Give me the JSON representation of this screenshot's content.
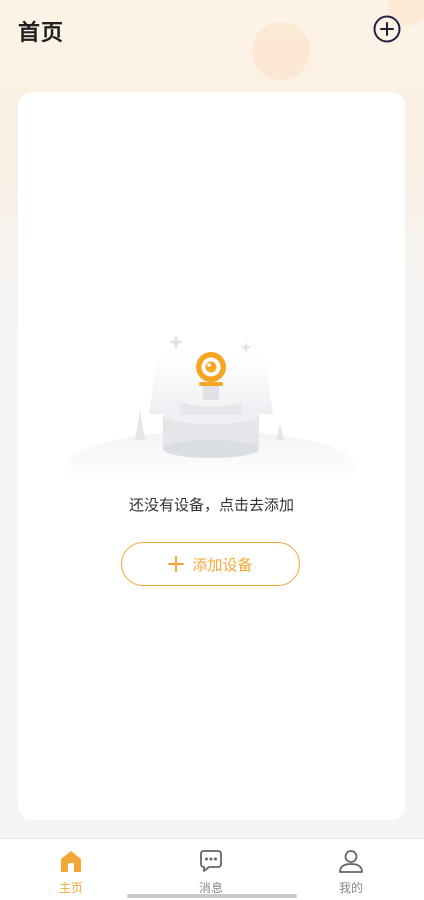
{
  "header": {
    "title": "首页",
    "add_icon": "plus-circle-icon"
  },
  "empty_state": {
    "illustration": "camera-on-pedestal-illustration",
    "message": "还没有设备，点击去添加",
    "add_button_label": "添加设备",
    "add_button_icon": "plus-icon"
  },
  "tabbar": {
    "items": [
      {
        "label": "主页",
        "icon": "home-icon",
        "active": true
      },
      {
        "label": "消息",
        "icon": "chat-bubble-icon",
        "active": false
      },
      {
        "label": "我的",
        "icon": "user-icon",
        "active": false
      }
    ]
  },
  "colors": {
    "accent": "#f3a737",
    "background": "#f4f5f7",
    "card": "#ffffff",
    "text_primary": "#1f1f1f",
    "tab_inactive": "#888888"
  }
}
